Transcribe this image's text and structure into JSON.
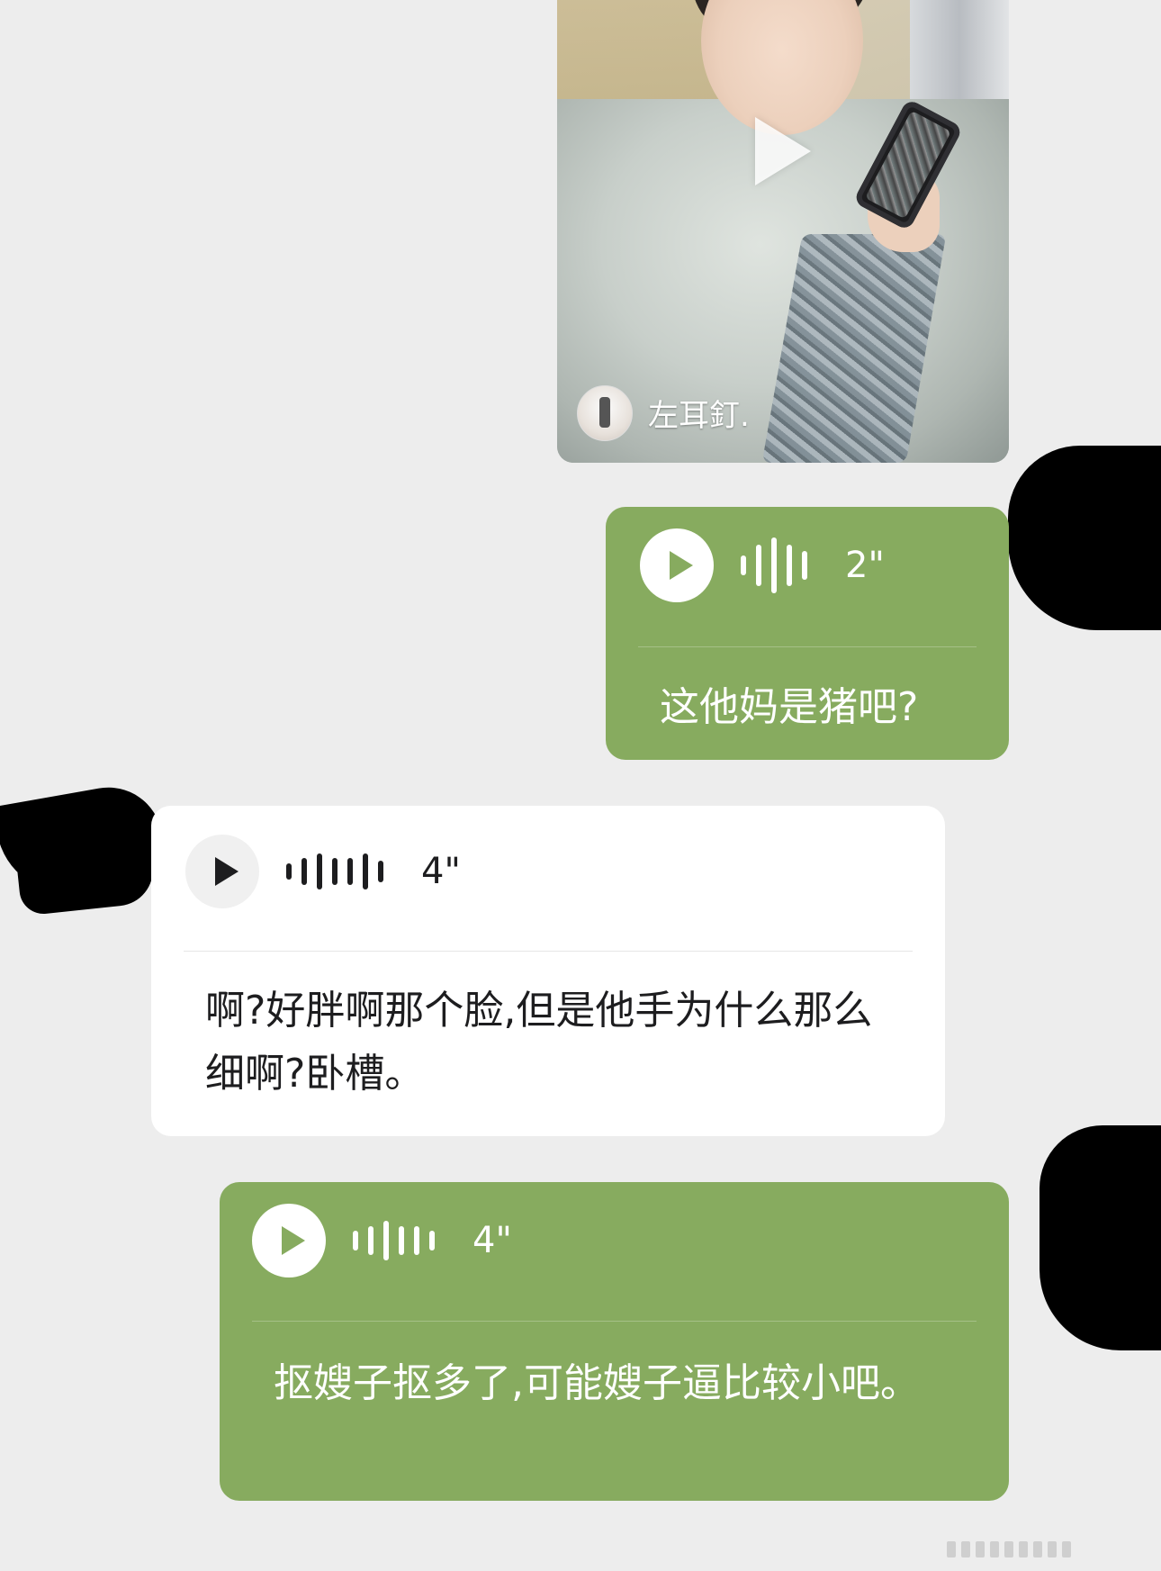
{
  "video_card": {
    "author_name": "左耳釘."
  },
  "messages": [
    {
      "side": "right",
      "style": "green",
      "duration": "2\"",
      "wave_heights": [
        22,
        46,
        62,
        46,
        32
      ],
      "text": "这他妈是猪吧?"
    },
    {
      "side": "left",
      "style": "white",
      "duration": "4\"",
      "wave_heights": [
        18,
        30,
        40,
        30,
        30,
        40,
        24
      ],
      "text": "啊?好胖啊那个脸,但是他手为什么那么细啊?卧槽。"
    },
    {
      "side": "right",
      "style": "green",
      "duration": "4\"",
      "wave_heights": [
        22,
        32,
        44,
        32,
        32,
        22
      ],
      "text": "抠嫂子抠多了,可能嫂子逼比较小吧。"
    }
  ],
  "colors": {
    "background": "#ededed",
    "green_bubble": "#87ab5f",
    "white_bubble": "#ffffff",
    "text_dark": "#1d1d1f"
  },
  "icons": {
    "video_play": "play-triangle-icon",
    "voice_play": "play-circle-icon",
    "voice_wave": "soundwave-icon"
  }
}
